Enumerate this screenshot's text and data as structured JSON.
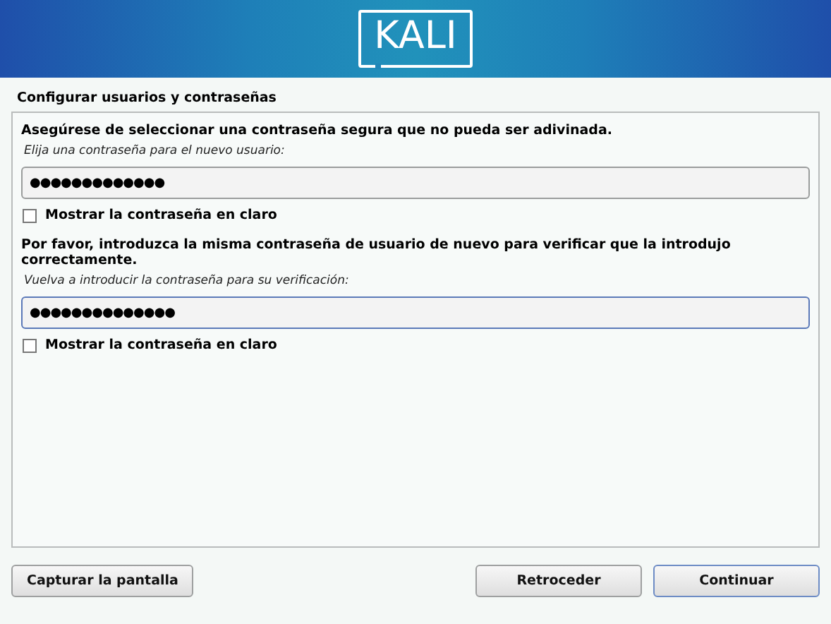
{
  "banner": {
    "logo": "KALI"
  },
  "page_title": "Configurar usuarios y contraseñas",
  "sections": [
    {
      "heading": "Asegúrese de seleccionar una contraseña segura que no pueda ser adivinada.",
      "prompt": "Elija una contraseña para el nuevo usuario:",
      "value": "●●●●●●●●●●●●●",
      "focused": false,
      "show_label": "Mostrar la contraseña en claro",
      "show_checked": false
    },
    {
      "heading": "Por favor, introduzca la misma contraseña de usuario de nuevo para verificar que la introdujo correctamente.",
      "prompt": "Vuelva a introducir la contraseña para su verificación:",
      "value": "●●●●●●●●●●●●●●",
      "focused": true,
      "show_label": "Mostrar la contraseña en claro",
      "show_checked": false
    }
  ],
  "buttons": [
    {
      "label": "Capturar la pantalla",
      "kind": "left",
      "default": false
    },
    {
      "label": "Retroceder",
      "kind": "right",
      "default": false
    },
    {
      "label": "Continuar",
      "kind": "right",
      "default": true
    }
  ]
}
